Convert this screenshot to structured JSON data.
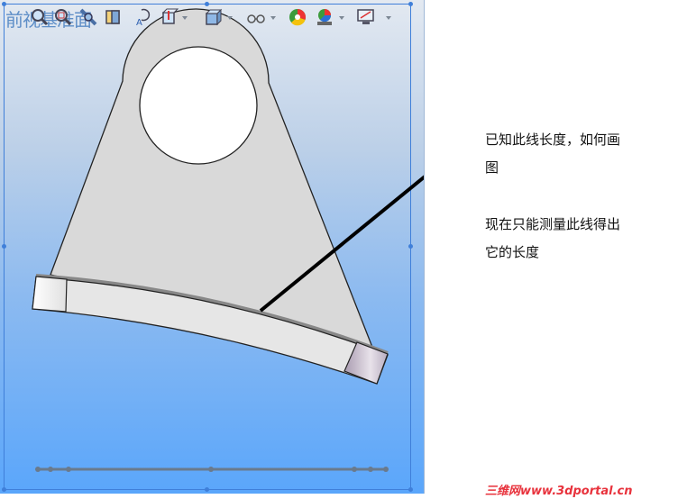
{
  "viewport": {
    "view_name": "前视基准面"
  },
  "toolbar": {
    "tools": [
      {
        "icon": "zoom-to-fit-icon"
      },
      {
        "icon": "zoom-area-icon"
      },
      {
        "icon": "rotate-view-icon"
      },
      {
        "icon": "section-view-icon"
      },
      {
        "icon": "dynamic-annotation-icon"
      },
      {
        "icon": "view-orientation-icon"
      },
      {
        "icon": "display-style-icon"
      },
      {
        "icon": "hide-show-items-icon"
      },
      {
        "icon": "edit-appearance-icon"
      },
      {
        "icon": "apply-scene-icon"
      },
      {
        "icon": "view-settings-icon"
      }
    ]
  },
  "annotation": {
    "line1": "已知此线长度，如何画",
    "line2": "图",
    "line3": "现在只能测量此线得出",
    "line4": "它的长度"
  },
  "watermark": "三维网www.3dportal.cn",
  "colors": {
    "part_fill": "#d9d9d9",
    "frame": "#3f7fd9",
    "watermark": "#e8323c"
  }
}
